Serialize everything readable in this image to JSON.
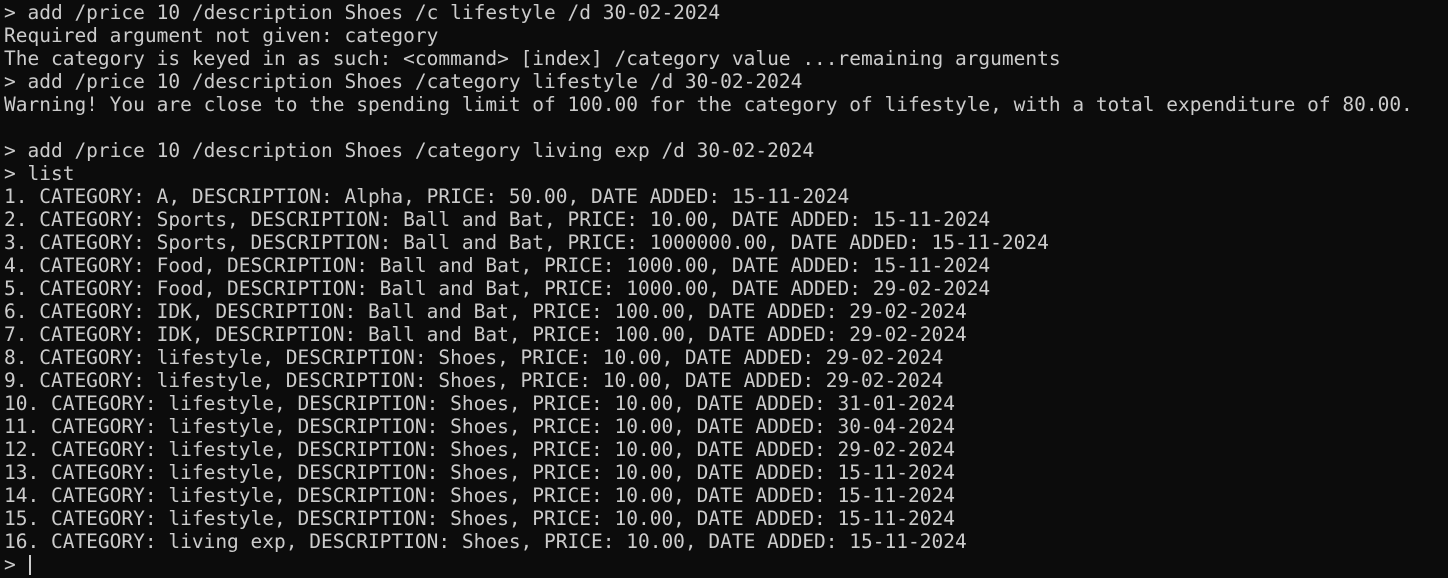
{
  "terminal": {
    "lines": [
      "> add /price 10 /description Shoes /c lifestyle /d 30-02-2024",
      "Required argument not given: category",
      "The category is keyed in as such: <command> [index] /category value ...remaining arguments",
      "> add /price 10 /description Shoes /category lifestyle /d 30-02-2024",
      "Warning! You are close to the spending limit of 100.00 for the category of lifestyle, with a total expenditure of 80.00.",
      "",
      "> add /price 10 /description Shoes /category living exp /d 30-02-2024",
      "> list",
      "1. CATEGORY: A, DESCRIPTION: Alpha, PRICE: 50.00, DATE ADDED: 15-11-2024",
      "2. CATEGORY: Sports, DESCRIPTION: Ball and Bat, PRICE: 10.00, DATE ADDED: 15-11-2024",
      "3. CATEGORY: Sports, DESCRIPTION: Ball and Bat, PRICE: 1000000.00, DATE ADDED: 15-11-2024",
      "4. CATEGORY: Food, DESCRIPTION: Ball and Bat, PRICE: 1000.00, DATE ADDED: 15-11-2024",
      "5. CATEGORY: Food, DESCRIPTION: Ball and Bat, PRICE: 1000.00, DATE ADDED: 29-02-2024",
      "6. CATEGORY: IDK, DESCRIPTION: Ball and Bat, PRICE: 100.00, DATE ADDED: 29-02-2024",
      "7. CATEGORY: IDK, DESCRIPTION: Ball and Bat, PRICE: 100.00, DATE ADDED: 29-02-2024",
      "8. CATEGORY: lifestyle, DESCRIPTION: Shoes, PRICE: 10.00, DATE ADDED: 29-02-2024",
      "9. CATEGORY: lifestyle, DESCRIPTION: Shoes, PRICE: 10.00, DATE ADDED: 29-02-2024",
      "10. CATEGORY: lifestyle, DESCRIPTION: Shoes, PRICE: 10.00, DATE ADDED: 31-01-2024",
      "11. CATEGORY: lifestyle, DESCRIPTION: Shoes, PRICE: 10.00, DATE ADDED: 30-04-2024",
      "12. CATEGORY: lifestyle, DESCRIPTION: Shoes, PRICE: 10.00, DATE ADDED: 29-02-2024",
      "13. CATEGORY: lifestyle, DESCRIPTION: Shoes, PRICE: 10.00, DATE ADDED: 15-11-2024",
      "14. CATEGORY: lifestyle, DESCRIPTION: Shoes, PRICE: 10.00, DATE ADDED: 15-11-2024",
      "15. CATEGORY: lifestyle, DESCRIPTION: Shoes, PRICE: 10.00, DATE ADDED: 15-11-2024",
      "16. CATEGORY: living exp, DESCRIPTION: Shoes, PRICE: 10.00, DATE ADDED: 15-11-2024"
    ],
    "prompt": ">",
    "input_value": ""
  },
  "colors": {
    "background": "#0c0c0c",
    "foreground": "#cccccc"
  }
}
